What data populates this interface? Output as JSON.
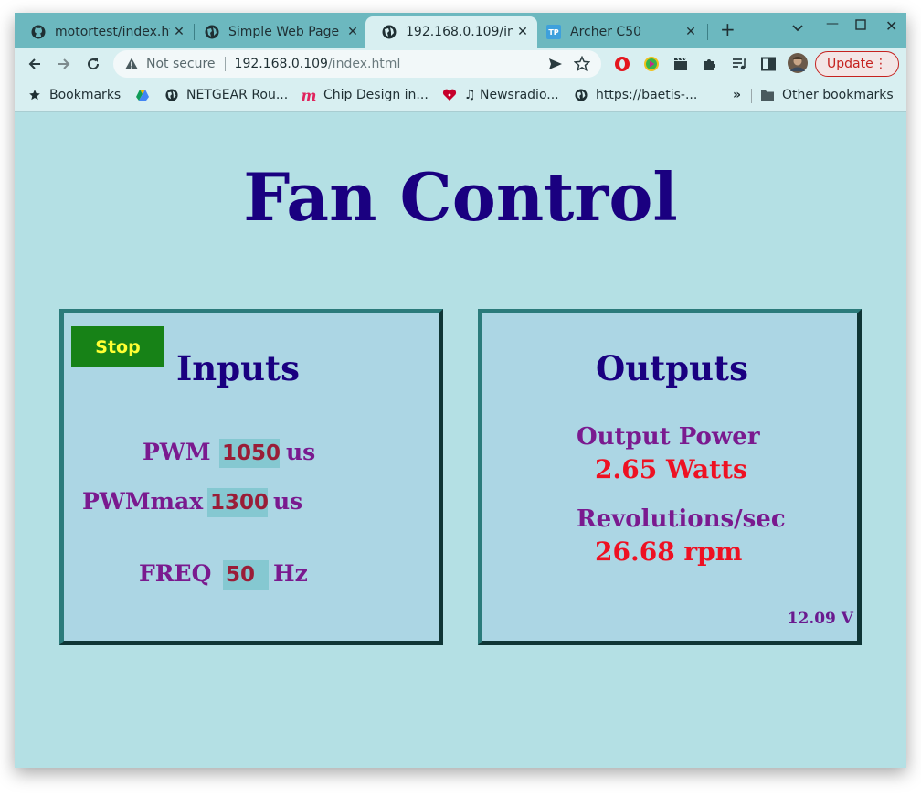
{
  "browser": {
    "tabs": [
      {
        "title": "motortest/index.html",
        "icon": "github-icon"
      },
      {
        "title": "Simple Web Page",
        "icon": "globe-icon"
      },
      {
        "title": "192.168.0.109/index.html",
        "icon": "globe-icon"
      },
      {
        "title": "Archer C50",
        "icon": "tp-link-icon"
      }
    ],
    "tp_icon_text": "TP",
    "address": {
      "security_label": "Not secure",
      "host": "192.168.0.109",
      "path": "/index.html"
    },
    "update_label": "Update",
    "bookmarks": [
      {
        "label": "Bookmarks",
        "icon": "star-icon"
      },
      {
        "label": "",
        "icon": "google-drive-icon"
      },
      {
        "label": "NETGEAR Rou...",
        "icon": "globe-icon"
      },
      {
        "label": "Chip Design in...",
        "icon": "m-logo-icon"
      },
      {
        "label": "♫ Newsradio...",
        "icon": "iheart-icon"
      },
      {
        "label": "https://baetis-...",
        "icon": "globe-icon"
      }
    ],
    "bookmarks_overflow": "»",
    "other_bookmarks": "Other bookmarks",
    "colors": {
      "tabstrip": "#6cb8bf",
      "toolbar": "#d8eff1",
      "update": "#c5221f"
    }
  },
  "page": {
    "title": "Fan Control",
    "inputs": {
      "heading": "Inputs",
      "stop_label": "Stop",
      "pwm": {
        "label": "PWM",
        "value": "1050",
        "unit": "us"
      },
      "pwmmax": {
        "label": "PWMmax",
        "value": "1300",
        "unit": "us"
      },
      "freq": {
        "label": "FREQ",
        "value": "50",
        "unit": "Hz"
      }
    },
    "outputs": {
      "heading": "Outputs",
      "power_label": "Output Power",
      "power_value": "2.65 Watts",
      "rev_label": "Revolutions/sec",
      "rev_value": "26.68 rpm",
      "voltage": "12.09 V"
    },
    "colors": {
      "background": "#b4e0e4",
      "title": "#1a0080",
      "label": "#7a1a8f",
      "value": "#ee1122",
      "stop_bg": "#178217",
      "stop_text": "#ffff33"
    }
  }
}
